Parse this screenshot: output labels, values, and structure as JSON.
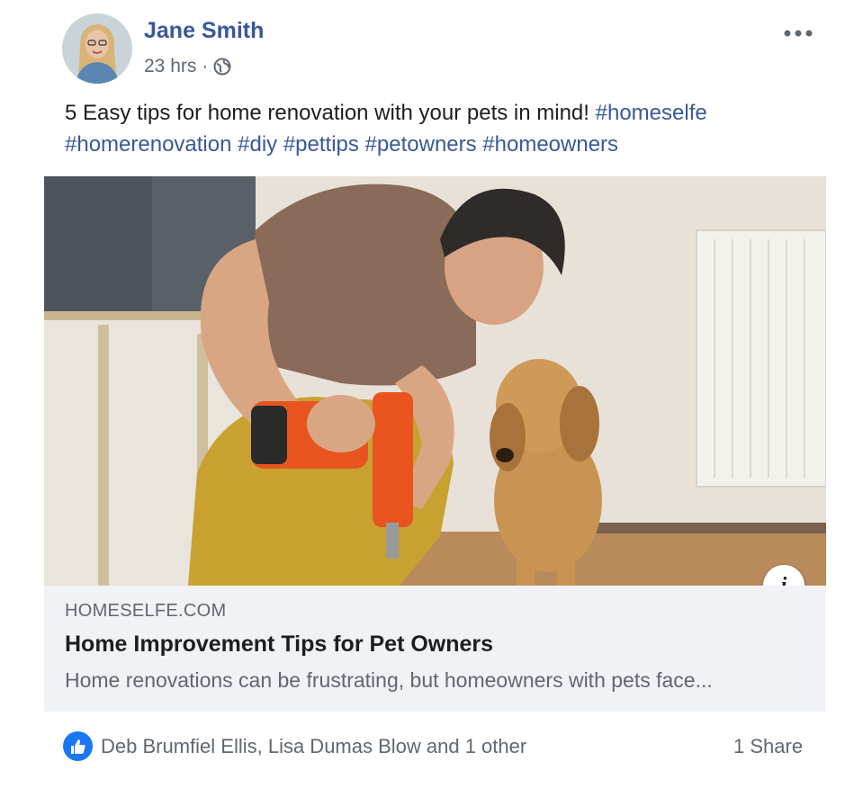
{
  "post": {
    "author": "Jane Smith",
    "time": "23 hrs",
    "separator": "·",
    "privacy_icon": "globe-icon",
    "more_icon": "more-options-icon",
    "text_main": "5 Easy tips for home renovation with your pets in mind!",
    "hashtags": "#homeselfe #homerenovation #diy #pettips #petowners #homeowners"
  },
  "link_preview": {
    "domain": "HOMESELFE.COM",
    "title": "Home Improvement Tips for Pet Owners",
    "description": "Home renovations can be frustrating, but homeowners with pets face...",
    "info_icon": "info-icon",
    "info_label": "i"
  },
  "reactions": {
    "like_icon": "thumbs-up-icon",
    "likers": "Deb Brumfiel Ellis, Lisa Dumas Blow and 1 other",
    "shares": "1 Share"
  },
  "colors": {
    "link_blue": "#385898",
    "like_blue": "#1877f2",
    "meta_gray": "#606770",
    "preview_bg": "#f0f2f5"
  }
}
